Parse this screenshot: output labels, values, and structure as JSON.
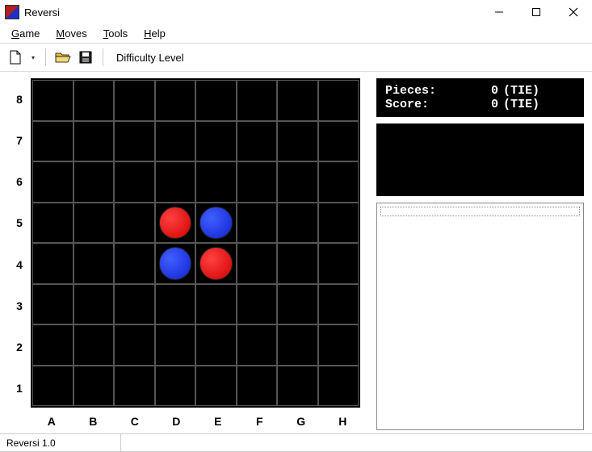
{
  "window": {
    "title": "Reversi"
  },
  "menu": {
    "game": {
      "label": "Game",
      "hotidx": 0
    },
    "moves": {
      "label": "Moves",
      "hotidx": 0
    },
    "tools": {
      "label": "Tools",
      "hotidx": 0
    },
    "help": {
      "label": "Help",
      "hotidx": 0
    }
  },
  "toolbar": {
    "difficulty_label": "Difficulty Level"
  },
  "board": {
    "ranks": [
      "1",
      "2",
      "3",
      "4",
      "5",
      "6",
      "7",
      "8"
    ],
    "files": [
      "A",
      "B",
      "C",
      "D",
      "E",
      "F",
      "G",
      "H"
    ],
    "pieces": [
      {
        "file": "D",
        "rank": 5,
        "color": "red"
      },
      {
        "file": "E",
        "rank": 5,
        "color": "blue"
      },
      {
        "file": "D",
        "rank": 4,
        "color": "blue"
      },
      {
        "file": "E",
        "rank": 4,
        "color": "red"
      }
    ]
  },
  "score_panel": {
    "pieces": {
      "label": "Pieces:",
      "value": "0",
      "status": "(TIE)"
    },
    "score": {
      "label": "Score:",
      "value": "0",
      "status": "(TIE)"
    }
  },
  "status": {
    "version": "Reversi 1.0"
  }
}
